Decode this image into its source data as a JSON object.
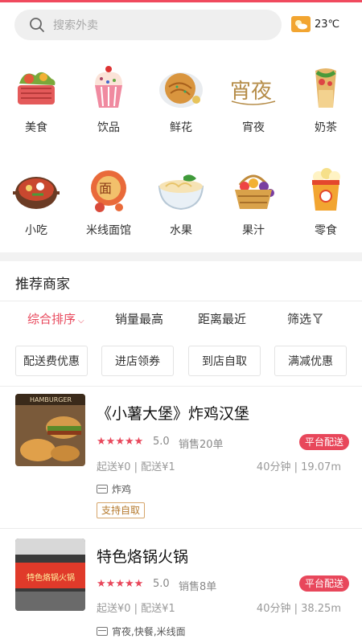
{
  "search": {
    "placeholder": "搜索外卖"
  },
  "weather": {
    "icon": "partly-cloudy-icon",
    "temp": "23℃"
  },
  "categories": [
    {
      "label": "美食",
      "icon": "food-basket-icon"
    },
    {
      "label": "饮品",
      "icon": "cupcake-icon"
    },
    {
      "label": "鲜花",
      "icon": "pancake-icon"
    },
    {
      "label": "宵夜",
      "icon": "night-snack-icon"
    },
    {
      "label": "奶茶",
      "icon": "wrap-icon"
    },
    {
      "label": "小吃",
      "icon": "hotpot-icon"
    },
    {
      "label": "米线面馆",
      "icon": "noodle-bowl-icon"
    },
    {
      "label": "水果",
      "icon": "ramen-icon"
    },
    {
      "label": "果汁",
      "icon": "fruit-basket-icon"
    },
    {
      "label": "零食",
      "icon": "popcorn-icon"
    }
  ],
  "recommend_title": "推荐商家",
  "sort_tabs": [
    "综合排序",
    "销量最高",
    "距离最近",
    "筛选"
  ],
  "filters": [
    "配送费优惠",
    "进店领券",
    "到店自取",
    "满减优惠"
  ],
  "colors": {
    "accent": "#e8475b",
    "pickup": "#b57a2e"
  },
  "shops": [
    {
      "name": "《小薯大堡》炸鸡汉堡",
      "image_text": "HAMBURGER",
      "rating": "5.0",
      "stars": 5,
      "sales": "销售20单",
      "badge": "平台配送",
      "fee": "起送¥0 | 配送¥1",
      "distance": "40分钟 | 19.07m",
      "tags": "炸鸡",
      "pickup": "支持自取"
    },
    {
      "name": "特色烙锅火锅",
      "image_text": "特色烙锅火锅",
      "rating": "5.0",
      "stars": 5,
      "sales": "销售8单",
      "badge": "平台配送",
      "fee": "起送¥0 | 配送¥1",
      "distance": "40分钟 | 38.25m",
      "tags": "宵夜,快餐,米线面"
    }
  ]
}
